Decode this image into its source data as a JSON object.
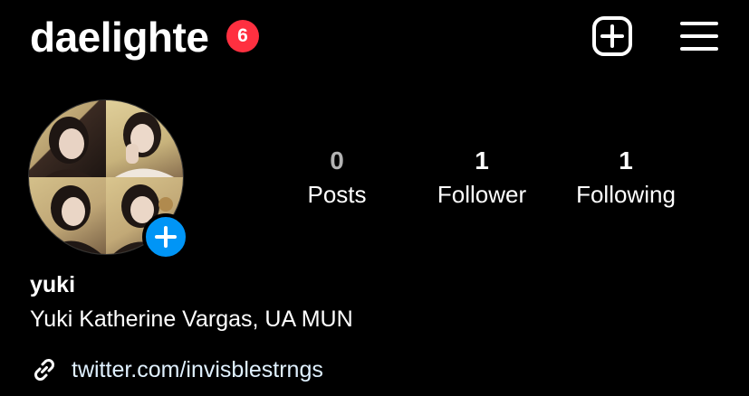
{
  "header": {
    "username": "daelighte",
    "notification_count": "6",
    "create_icon": "plus-square-icon",
    "menu_icon": "hamburger-menu-icon"
  },
  "profile": {
    "avatar_alt": "profile photo collage",
    "add_story_icon": "plus-icon"
  },
  "stats": [
    {
      "count": "0",
      "label": "Posts"
    },
    {
      "count": "1",
      "label": "Follower"
    },
    {
      "count": "1",
      "label": "Following"
    }
  ],
  "bio": {
    "name": "yuki",
    "text": "Yuki Katherine Vargas, UA MUN",
    "link_icon": "link-icon",
    "link": "twitter.com/invisblestrngs"
  },
  "colors": {
    "background": "#000000",
    "badge": "#ff3040",
    "accent": "#0095f6",
    "text": "#ffffff",
    "link": "#e0f1ff"
  }
}
